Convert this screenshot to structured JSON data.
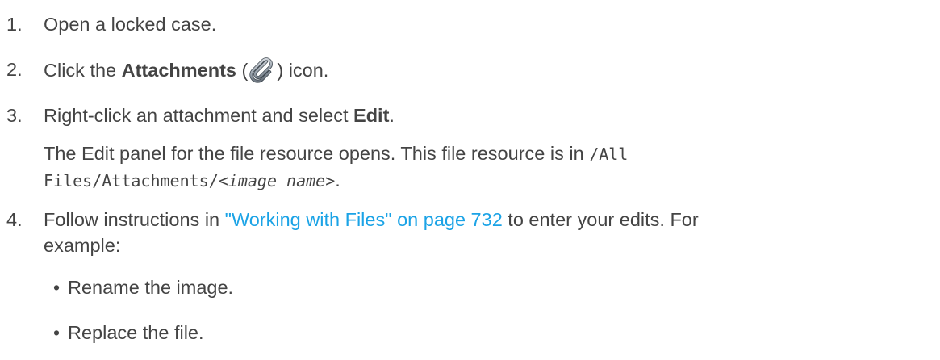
{
  "steps": [
    {
      "number": "1.",
      "text": "Open a locked case."
    },
    {
      "number": "2.",
      "prefix": "Click the ",
      "bold": "Attachments",
      "open": " (",
      "icon": "paperclip-icon",
      "close": ") icon."
    },
    {
      "number": "3.",
      "prefix": "Right-click an attachment and select ",
      "bold": "Edit",
      "suffix": "."
    },
    {
      "number": "4.",
      "prefix": "Follow instructions in ",
      "link": "\"Working with Files\" on page 732",
      "suffix": " to enter your edits. For",
      "line2": "example:"
    }
  ],
  "note": {
    "prefix": "The Edit panel for the file resource opens. This file resource is in ",
    "path1": "/All",
    "path2a": "Files/Attachments/<",
    "path2b": "image_name",
    "path2c": ">",
    "suffix": "."
  },
  "bullets": [
    {
      "marker": "•",
      "text": "Rename the image."
    },
    {
      "marker": "•",
      "text": "Replace the file."
    }
  ],
  "colors": {
    "text": "#444444",
    "link": "#1ba3e6"
  }
}
